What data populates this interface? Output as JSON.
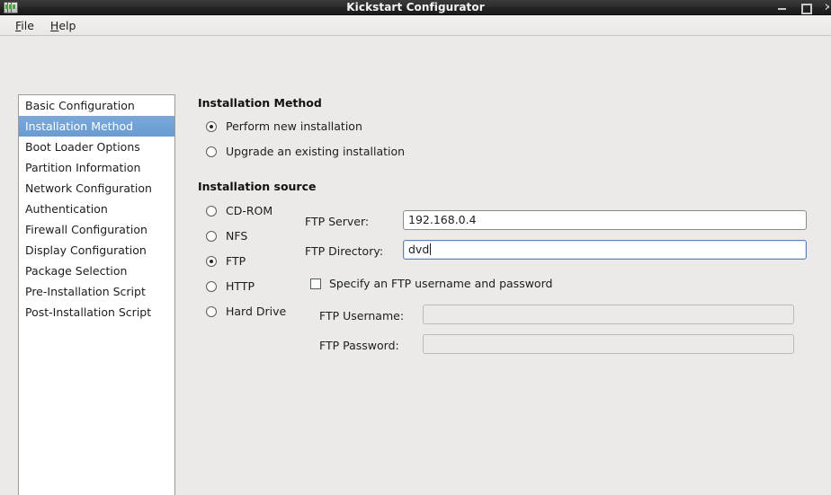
{
  "window": {
    "title": "Kickstart Configurator",
    "icon": "packages-icon",
    "controls": {
      "minimize": "minimize-icon",
      "maximize": "maximize-icon",
      "close": "close-icon"
    }
  },
  "menubar": {
    "items": [
      {
        "label": "File",
        "mnemonic": "F"
      },
      {
        "label": "Help",
        "mnemonic": "H"
      }
    ]
  },
  "sidebar": {
    "items": [
      {
        "label": "Basic Configuration",
        "selected": false
      },
      {
        "label": "Installation Method",
        "selected": true
      },
      {
        "label": "Boot Loader Options",
        "selected": false
      },
      {
        "label": "Partition Information",
        "selected": false
      },
      {
        "label": "Network Configuration",
        "selected": false
      },
      {
        "label": "Authentication",
        "selected": false
      },
      {
        "label": "Firewall Configuration",
        "selected": false
      },
      {
        "label": "Display Configuration",
        "selected": false
      },
      {
        "label": "Package Selection",
        "selected": false
      },
      {
        "label": "Pre-Installation Script",
        "selected": false
      },
      {
        "label": "Post-Installation Script",
        "selected": false
      }
    ],
    "selected_color": "#6a9bd1"
  },
  "main": {
    "installation_method": {
      "title": "Installation Method",
      "options": [
        {
          "label": "Perform new installation",
          "selected": true
        },
        {
          "label": "Upgrade an existing installation",
          "selected": false
        }
      ]
    },
    "installation_source": {
      "title": "Installation source",
      "options": [
        {
          "label": "CD-ROM",
          "selected": false
        },
        {
          "label": "NFS",
          "selected": false
        },
        {
          "label": "FTP",
          "selected": true
        },
        {
          "label": "HTTP",
          "selected": false
        },
        {
          "label": "Hard Drive",
          "selected": false
        }
      ],
      "ftp_server": {
        "label": "FTP Server:",
        "value": "192.168.0.4",
        "focused": false,
        "disabled": false
      },
      "ftp_directory": {
        "label": "FTP Directory:",
        "value": "dvd",
        "focused": true,
        "disabled": false
      },
      "specify_credentials": {
        "label": "Specify an FTP username and password",
        "checked": false
      },
      "ftp_username": {
        "label": "FTP Username:",
        "value": "",
        "disabled": true
      },
      "ftp_password": {
        "label": "FTP Password:",
        "value": "",
        "disabled": true
      }
    }
  }
}
